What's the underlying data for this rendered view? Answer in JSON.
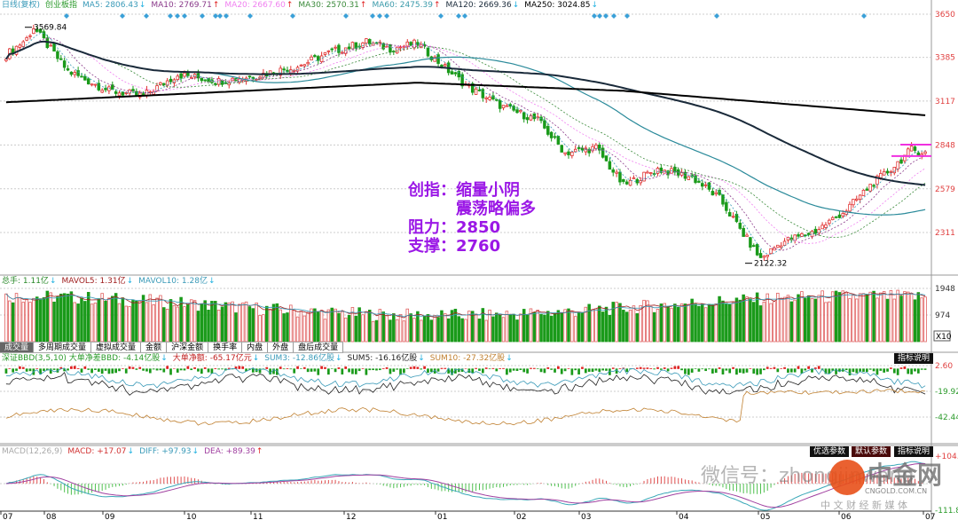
{
  "header": {
    "period": "日线(复权)",
    "name": "创业板指",
    "ma": [
      {
        "label": "MA5: 2806.43",
        "dir": "↓",
        "color": "#3a9ab8"
      },
      {
        "label": "MA10: 2769.71",
        "dir": "↑",
        "color": "#8a3a8a"
      },
      {
        "label": "MA20: 2667.60",
        "dir": "↑",
        "color": "#f080f0"
      },
      {
        "label": "MA30: 2570.31",
        "dir": "↑",
        "color": "#3a8a3a"
      },
      {
        "label": "MA60: 2475.39",
        "dir": "↑",
        "color": "#3a9aaa"
      },
      {
        "label": "MA120: 2669.36",
        "dir": "↓",
        "color": "#1a2a3a"
      },
      {
        "label": "MA250: 3024.85",
        "dir": "↓",
        "color": "#000000"
      }
    ]
  },
  "price_axis": [
    "3650",
    "3385",
    "3117",
    "2848",
    "2579",
    "2311"
  ],
  "annotations": {
    "high": "3569.84",
    "low": "2122.32",
    "note": [
      "创指：缩量小阴",
      "　　　震荡略偏多",
      "阻力：2850",
      "支撑：2760"
    ]
  },
  "volume": {
    "header": [
      {
        "label": "总手: 1.11亿",
        "dir": "↓",
        "color": "#2a8a2a"
      },
      {
        "label": "MAVOL5: 1.31亿",
        "dir": "↓",
        "color": "#a02020"
      },
      {
        "label": "MAVOL10: 1.28亿",
        "dir": "↓",
        "color": "#3a9ab8"
      }
    ],
    "axis": [
      "1948",
      "974"
    ],
    "unit": "X10"
  },
  "tabs": [
    "成交量",
    "多周期成交量",
    "虚拟成交量",
    "金额",
    "沪深金额",
    "换手率",
    "内盘",
    "外盘",
    "盘后成交量"
  ],
  "bbd": {
    "header": [
      {
        "label": "深证BBD(3,5,10) 大单净差BBD: -4.14亿股",
        "dir": "↓",
        "color": "#2a9a2a"
      },
      {
        "label": "大单净额: -65.17亿元",
        "dir": "↓",
        "color": "#c02020"
      },
      {
        "label": "SUM3: -12.86亿股",
        "dir": "↓",
        "color": "#3a9ab8"
      },
      {
        "label": "SUM5: -16.16亿股",
        "dir": "↓",
        "color": "#222"
      },
      {
        "label": "SUM10: -27.32亿股",
        "dir": "↓",
        "color": "#c08030"
      }
    ],
    "axis": [
      "2.60",
      "-19.92",
      "-42.44"
    ],
    "button": "指标说明"
  },
  "macd": {
    "header": [
      {
        "label": "MACD(12,26,9)",
        "dir": "",
        "color": "#aaa"
      },
      {
        "label": "MACD: +17.07",
        "dir": "↓",
        "color": "#d03030"
      },
      {
        "label": "DIFF: +97.93",
        "dir": "↓",
        "color": "#3a9ab8"
      },
      {
        "label": "DEA: +89.39",
        "dir": "↑",
        "color": "#a040a0"
      }
    ],
    "axis": [
      "+104.1",
      "-111.8"
    ],
    "buttons": [
      "优选参数",
      "默认参数",
      "指标说明"
    ]
  },
  "x_axis": [
    "07",
    "08",
    "09",
    "10",
    "11",
    "12",
    "01",
    "02",
    "03",
    "04",
    "05",
    "06",
    "07"
  ],
  "watermark": {
    "wechat": "微信号：zhongjinwang",
    "brand": "中金网",
    "domain": "CNGOLD.COM.CN",
    "slogan": "中 文 财 经 新 媒 体"
  },
  "chart_data": {
    "type": "candlestick",
    "title": "创业板指 日线(复权)",
    "close_keypoints": [
      [
        0,
        3400
      ],
      [
        6,
        3500
      ],
      [
        8,
        3569
      ],
      [
        18,
        3300
      ],
      [
        30,
        3180
      ],
      [
        40,
        3150
      ],
      [
        50,
        3280
      ],
      [
        62,
        3240
      ],
      [
        72,
        3270
      ],
      [
        85,
        3330
      ],
      [
        95,
        3420
      ],
      [
        105,
        3480
      ],
      [
        112,
        3440
      ],
      [
        120,
        3470
      ],
      [
        128,
        3320
      ],
      [
        135,
        3200
      ],
      [
        145,
        3080
      ],
      [
        155,
        3000
      ],
      [
        163,
        2800
      ],
      [
        172,
        2830
      ],
      [
        180,
        2600
      ],
      [
        190,
        2700
      ],
      [
        200,
        2650
      ],
      [
        208,
        2520
      ],
      [
        215,
        2300
      ],
      [
        220,
        2150
      ],
      [
        226,
        2250
      ],
      [
        236,
        2320
      ],
      [
        245,
        2450
      ],
      [
        252,
        2600
      ],
      [
        258,
        2700
      ],
      [
        264,
        2820
      ],
      [
        268,
        2800
      ]
    ],
    "ma250_keypoints": [
      [
        0,
        3110
      ],
      [
        60,
        3170
      ],
      [
        120,
        3230
      ],
      [
        180,
        3180
      ],
      [
        268,
        3030
      ]
    ],
    "ylim": [
      2070,
      3680
    ],
    "colors": {
      "up": "#e03030",
      "down": "#1a9a1a"
    }
  }
}
